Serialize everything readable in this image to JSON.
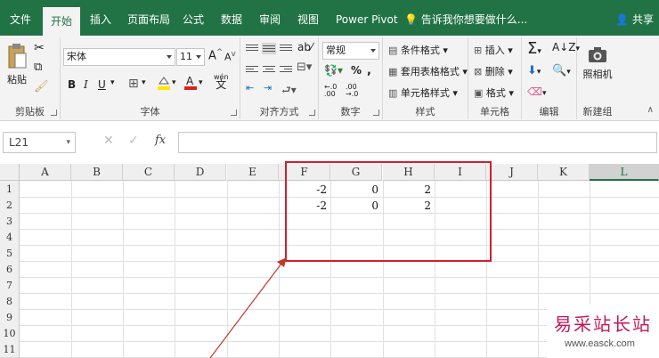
{
  "tabs": [
    {
      "label": "文件",
      "active": false
    },
    {
      "label": "开始",
      "active": true
    },
    {
      "label": "插入",
      "active": false
    },
    {
      "label": "页面布局",
      "active": false
    },
    {
      "label": "公式",
      "active": false
    },
    {
      "label": "数据",
      "active": false
    },
    {
      "label": "审阅",
      "active": false
    },
    {
      "label": "视图",
      "active": false
    },
    {
      "label": "Power Pivot",
      "active": false
    }
  ],
  "tell_me": "告诉我你想要做什么...",
  "share": "共享",
  "groups": {
    "clipboard": {
      "label": "剪贴板",
      "paste": "粘贴"
    },
    "font": {
      "label": "字体",
      "font_name": "宋体",
      "font_size": "11",
      "bold": "B",
      "italic": "I",
      "underline": "U",
      "grow": "A",
      "shrink": "A",
      "phonetic": "wén"
    },
    "alignment": {
      "label": "对齐方式"
    },
    "number": {
      "label": "数字",
      "format": "常规",
      "percent": "%",
      "comma": ","
    },
    "styles": {
      "label": "样式",
      "conditional": "条件格式",
      "table": "套用表格格式",
      "cell_styles": "单元格样式"
    },
    "cells": {
      "label": "单元格",
      "insert": "插入",
      "delete": "删除",
      "format": "格式"
    },
    "editing": {
      "label": "编辑"
    },
    "camera": {
      "label": "新建组",
      "button": "照相机"
    }
  },
  "formula_bar": {
    "name_box": "L21",
    "cancel": "✕",
    "enter": "✓",
    "fx": "fx",
    "formula": ""
  },
  "columns": [
    "A",
    "B",
    "C",
    "D",
    "E",
    "F",
    "G",
    "H",
    "I",
    "J",
    "K",
    "L"
  ],
  "selected_column": "L",
  "rows": [
    "1",
    "2",
    "3",
    "4",
    "5",
    "6",
    "7",
    "8",
    "9",
    "10",
    "11"
  ],
  "cells": [
    {
      "col": "F",
      "row": "1",
      "value": "-2"
    },
    {
      "col": "G",
      "row": "1",
      "value": "0"
    },
    {
      "col": "H",
      "row": "1",
      "value": "2"
    },
    {
      "col": "F",
      "row": "2",
      "value": "-2"
    },
    {
      "col": "G",
      "row": "2",
      "value": "0"
    },
    {
      "col": "H",
      "row": "2",
      "value": "2"
    }
  ],
  "watermark": {
    "line1": "易采站长站",
    "line2": "www.easck.com"
  },
  "colors": {
    "excel_green": "#217346",
    "annotation_red": "#d01f2e"
  }
}
